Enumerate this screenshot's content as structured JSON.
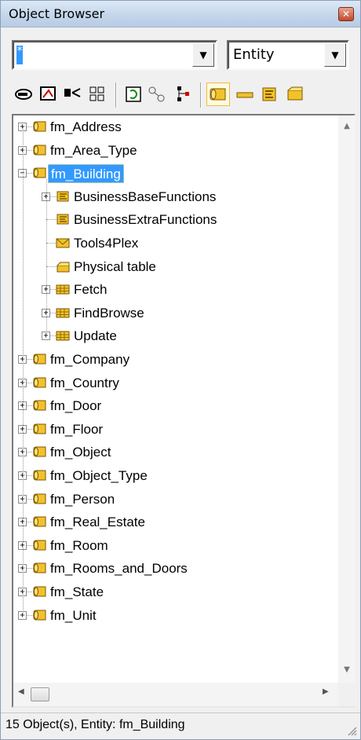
{
  "window": {
    "title": "Object Browser"
  },
  "filter": {
    "value": "*",
    "type_value": "Entity"
  },
  "toolbar": {
    "icons": [
      "key-icon",
      "diagram-icon",
      "split-icon",
      "grid-icon",
      "refresh-icon",
      "links-icon",
      "hierarchy-icon",
      "entity-icon",
      "field-icon",
      "function-icon",
      "table-icon"
    ]
  },
  "tree": {
    "nodes": [
      {
        "label": "fm_Address",
        "level": 0,
        "icon": "entity-icon",
        "expander": "+"
      },
      {
        "label": "fm_Area_Type",
        "level": 0,
        "icon": "entity-icon",
        "expander": "+"
      },
      {
        "label": "fm_Building",
        "level": 0,
        "icon": "entity-icon",
        "expander": "−",
        "selected": true
      },
      {
        "label": "BusinessBaseFunctions",
        "level": 1,
        "icon": "function-icon",
        "expander": "+"
      },
      {
        "label": "BusinessExtraFunctions",
        "level": 1,
        "icon": "function-icon",
        "expander": ""
      },
      {
        "label": "Tools4Plex",
        "level": 1,
        "icon": "envelope-icon",
        "expander": ""
      },
      {
        "label": "Physical table",
        "level": 1,
        "icon": "table-icon",
        "expander": ""
      },
      {
        "label": "Fetch",
        "level": 1,
        "icon": "view-icon",
        "expander": "+"
      },
      {
        "label": "FindBrowse",
        "level": 1,
        "icon": "view-icon",
        "expander": "+"
      },
      {
        "label": "Update",
        "level": 1,
        "icon": "view-icon",
        "expander": "+"
      },
      {
        "label": "fm_Company",
        "level": 0,
        "icon": "entity-icon",
        "expander": "+"
      },
      {
        "label": "fm_Country",
        "level": 0,
        "icon": "entity-icon",
        "expander": "+"
      },
      {
        "label": "fm_Door",
        "level": 0,
        "icon": "entity-icon",
        "expander": "+"
      },
      {
        "label": "fm_Floor",
        "level": 0,
        "icon": "entity-icon",
        "expander": "+"
      },
      {
        "label": "fm_Object",
        "level": 0,
        "icon": "entity-icon",
        "expander": "+"
      },
      {
        "label": "fm_Object_Type",
        "level": 0,
        "icon": "entity-icon",
        "expander": "+"
      },
      {
        "label": "fm_Person",
        "level": 0,
        "icon": "entity-icon",
        "expander": "+"
      },
      {
        "label": "fm_Real_Estate",
        "level": 0,
        "icon": "entity-icon",
        "expander": "+"
      },
      {
        "label": "fm_Room",
        "level": 0,
        "icon": "entity-icon",
        "expander": "+"
      },
      {
        "label": "fm_Rooms_and_Doors",
        "level": 0,
        "icon": "entity-icon",
        "expander": "+"
      },
      {
        "label": "fm_State",
        "level": 0,
        "icon": "entity-icon",
        "expander": "+"
      },
      {
        "label": "fm_Unit",
        "level": 0,
        "icon": "entity-icon",
        "expander": "+"
      }
    ]
  },
  "status": {
    "text": "15 Object(s), Entity: fm_Building"
  },
  "colors": {
    "selection": "#3399ff",
    "entity": "#f3c12b"
  }
}
